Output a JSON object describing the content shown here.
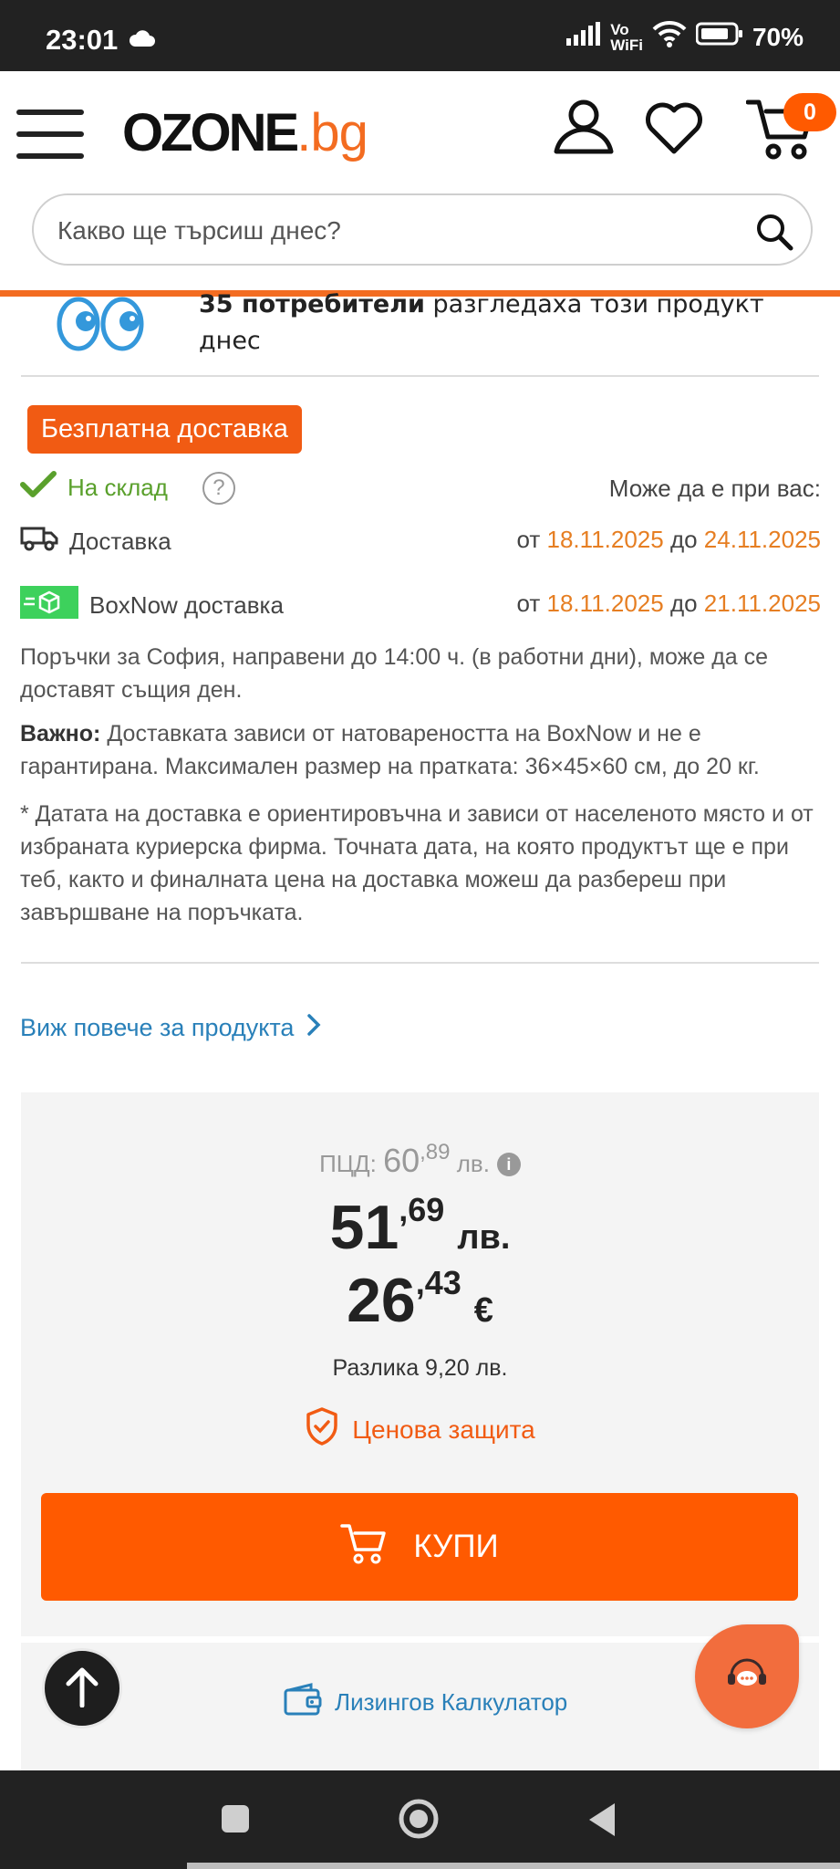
{
  "status_bar": {
    "time": "23:01",
    "volte_top": "Vo",
    "volte_bottom": "WiFi",
    "battery": "70%"
  },
  "header": {
    "logo_main": "OZONE",
    "logo_tld": ".bg",
    "cart_count": "0"
  },
  "search": {
    "placeholder": "Какво ще търсиш днес?"
  },
  "viewers": {
    "count_text": "35 потребители",
    "rest_text": " разгледаха този продукт днес"
  },
  "badges": {
    "free_delivery": "Безплатна доставка"
  },
  "stock": {
    "label": "На склад",
    "help": "?",
    "right_text": "Може да е при вас:"
  },
  "delivery": {
    "label": "Доставка",
    "from_word": "от ",
    "from_date": "18.11.2025",
    "to_word": " до ",
    "to_date": "24.11.2025"
  },
  "boxnow": {
    "label": "BoxNow доставка",
    "from_word": "от ",
    "from_date": "18.11.2025",
    "to_word": " до ",
    "to_date": "21.11.2025"
  },
  "info": {
    "sofia": "Поръчки за София, направени до 14:00 ч. (в работни дни), може да се доставят същия ден.",
    "important_label": "Важно:",
    "important_text": " Доставката зависи от натовареността на BoxNow и не е гарантирана. Максимален размер на пратката: 36×45×60 см, до 20 кг.",
    "disclaimer": "* Датата на доставка е ориентировъчна и зависи от населеното място и от избраната куриерска фирма. Точната дата, на която продуктът ще е при теб, както и финалната цена на доставка можеш да разбереш при завършване на поръчката."
  },
  "more_link": "Виж повече за продукта",
  "price": {
    "pcd_label": "ПЦД: ",
    "pcd_int": "60",
    "pcd_dec": ",89",
    "pcd_cur": " лв.",
    "bgn_int": "51",
    "bgn_dec": ",69",
    "bgn_cur": "лв.",
    "eur_int": "26",
    "eur_dec": ",43",
    "eur_cur": "€",
    "difference": "Разлика 9,20 лв.",
    "protection": "Ценова защита",
    "buy": "КУПИ"
  },
  "leasing": "Лизингов Калкулатор",
  "colors": {
    "brand_orange": "#ff5a00",
    "date_orange": "#e67e22",
    "link_blue": "#2980b9",
    "stock_green": "#5aa02c"
  }
}
